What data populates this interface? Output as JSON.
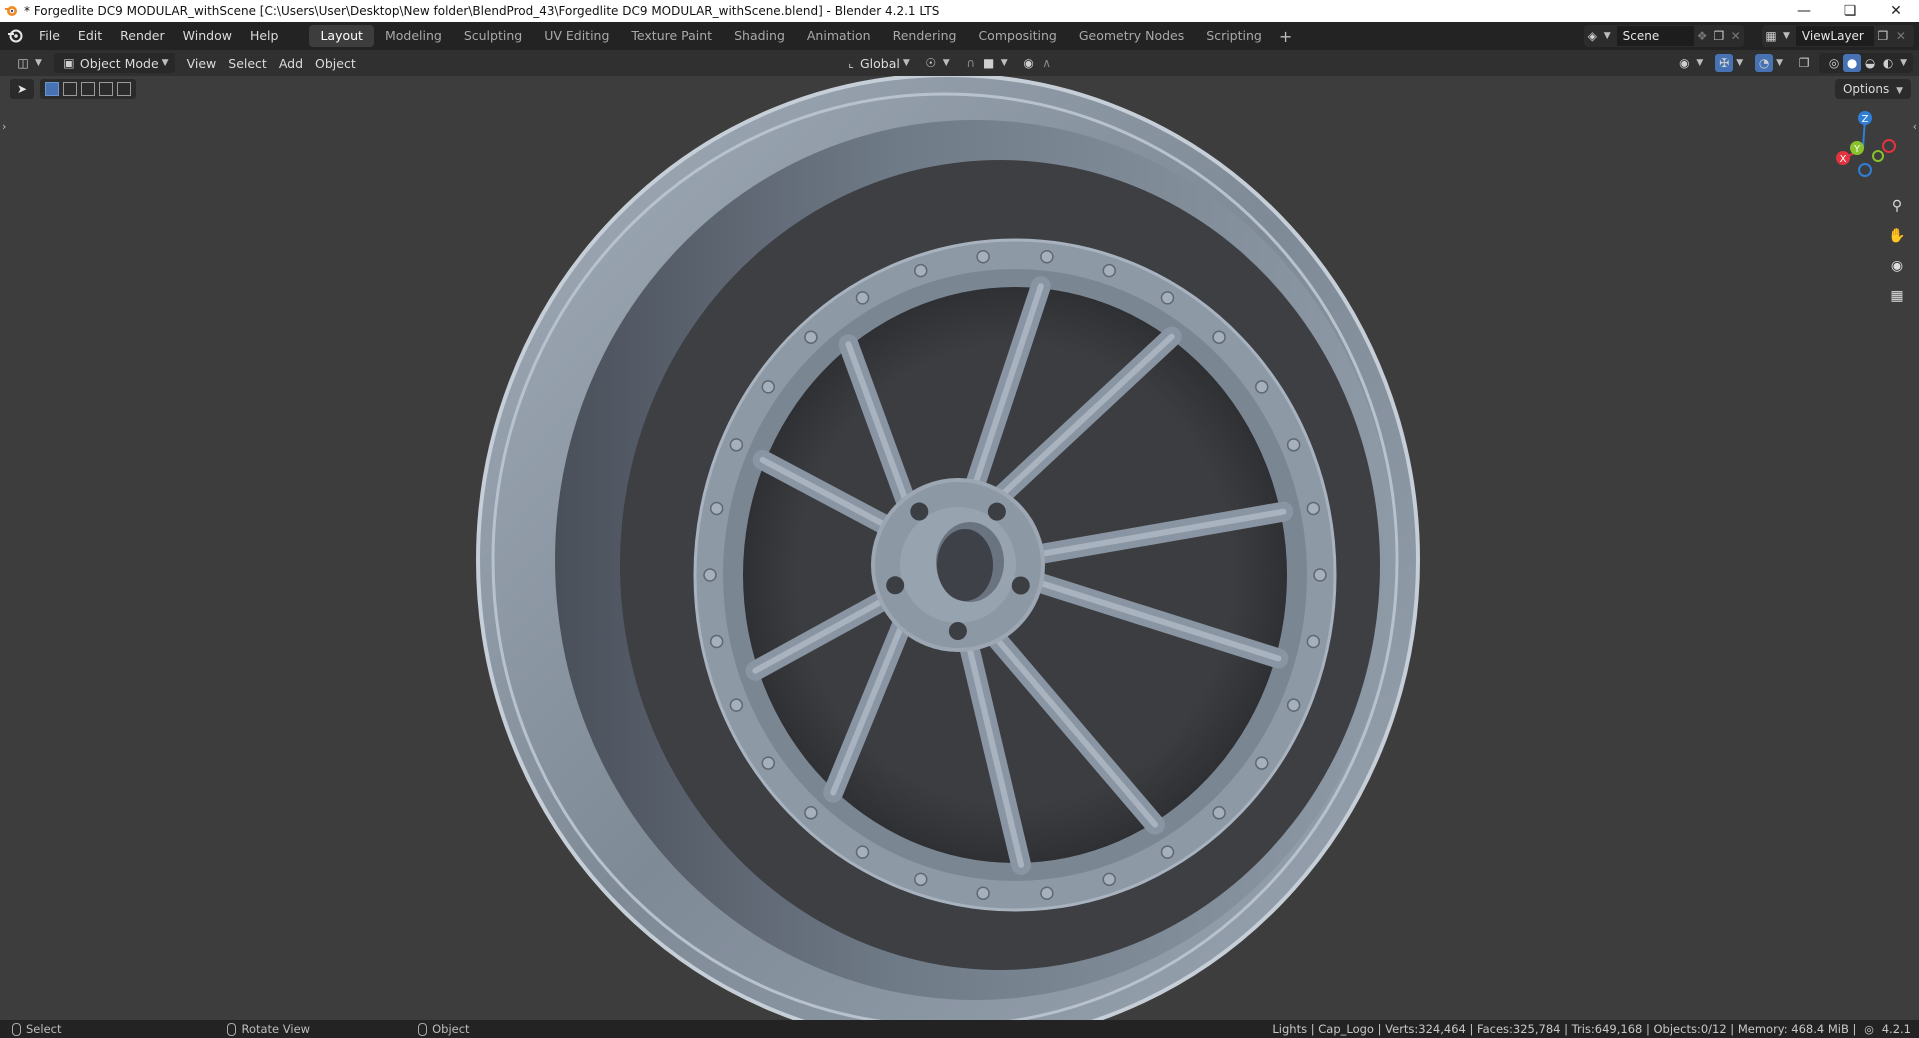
{
  "window": {
    "title": "* Forgedlite DC9 MODULAR_withScene [C:\\Users\\User\\Desktop\\New folder\\BlendProd_43\\Forgedlite DC9 MODULAR_withScene.blend] - Blender 4.2.1 LTS",
    "minimize_icon": "minimize-icon",
    "maximize_icon": "restore-icon",
    "close_icon": "close-icon"
  },
  "menubar": {
    "items": [
      "File",
      "Edit",
      "Render",
      "Window",
      "Help"
    ]
  },
  "workspaces": {
    "tabs": [
      "Layout",
      "Modeling",
      "Sculpting",
      "UV Editing",
      "Texture Paint",
      "Shading",
      "Animation",
      "Rendering",
      "Compositing",
      "Geometry Nodes",
      "Scripting"
    ],
    "active": "Layout",
    "add_label": "+"
  },
  "scene": {
    "name": "Scene"
  },
  "view_layer": {
    "name": "ViewLayer"
  },
  "header": {
    "mode": "Object Mode",
    "menus": [
      "View",
      "Select",
      "Add",
      "Object"
    ],
    "orientation": "Global"
  },
  "viewport": {
    "options_label": "Options",
    "gizmo": {
      "z": "Z",
      "y": "Y",
      "x": "X"
    },
    "object": "wheel-rim-model",
    "colors": {
      "background": "#3d3d3d",
      "rim": "#8b97a6",
      "x_axis": "#e2333f",
      "y_axis": "#8ac22a",
      "z_axis": "#2f7fd6"
    }
  },
  "statusbar": {
    "hints": [
      "Select",
      "Rotate View",
      "Object"
    ],
    "stats": "Lights | Cap_Logo | Verts:324,464 | Faces:325,784 | Tris:649,168 | Objects:0/12 | Memory: 468.4 MiB | ",
    "version": "4.2.1"
  }
}
